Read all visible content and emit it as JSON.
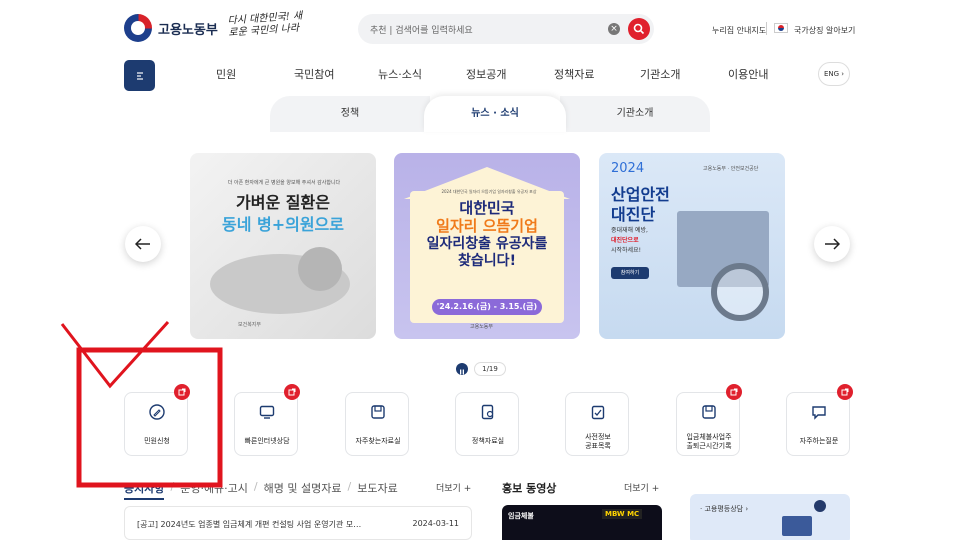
{
  "header": {
    "logo_text": "고용노동부",
    "slogan": "다시 대한민국! 새로운 국민의 나라",
    "search_placeholder": "추천 | 검색어를 입력하세요",
    "util_sitemap": "누리집 안내지도",
    "util_gov": "국가상징 알아보기"
  },
  "nav": {
    "items": [
      "민원",
      "국민참여",
      "뉴스·소식",
      "정보공개",
      "정책자료",
      "기관소개",
      "이용안내"
    ],
    "eng": "ENG"
  },
  "subtabs": [
    "정책",
    "뉴스 · 소식",
    "기관소개"
  ],
  "carousel": {
    "card1": {
      "small": "더 아픈 환자에게 큰 병원을 양보해 주셔서 감사합니다",
      "line1": "가벼운 질환은",
      "line2": "동네 병+의원으로",
      "footer": "보건복지부"
    },
    "card2": {
      "small": "2024 대한민국 일자리 으뜸기업 일자리창출 유공자 포상",
      "line1": "대한민국",
      "line2": "일자리 으뜸기업",
      "line3": "일자리창출 유공자를",
      "line4": "찾습니다!",
      "date": "'24.2.16.(금) - 3.15.(금)",
      "footer": "고용노동부"
    },
    "card3": {
      "year": "2024",
      "title1": "산업안전",
      "title2": "대진단",
      "sub1": "중대재해 예방,",
      "sub2": "대진단으로",
      "sub3": "시작하세요!",
      "btn": "참여하기",
      "brand": "고용노동부 · 안전보건공단"
    },
    "pager": "1/19"
  },
  "quick_menu": [
    {
      "label": "민원신청"
    },
    {
      "label": "빠른인터넷상담"
    },
    {
      "label": "자주찾는자료실"
    },
    {
      "label": "정책자료실"
    },
    {
      "label": "사전정보\n공표목록"
    },
    {
      "label": "입금체불사업주\n출퇴근시간기록"
    },
    {
      "label": "자주하는질문"
    }
  ],
  "news": {
    "tabs": [
      "공지사항",
      "운영·예규·고시",
      "해명 및 설명자료",
      "보도자료"
    ],
    "more": "더보기 +",
    "item_title": "[공고] 2024년도 업종별 임금체계 개편 컨설팅 사업 운영기관 모…",
    "item_date": "2024-03-11"
  },
  "video": {
    "title": "홍보 동영상",
    "more": "더보기 +",
    "thumb_text1": "임금체불",
    "thumb_text2": "MBW MC"
  },
  "banner": {
    "label": "· 고용평등상담 ›"
  },
  "colors": {
    "primary": "#1d3b70",
    "accent": "#e0202d",
    "annotation": "#e0141e"
  }
}
